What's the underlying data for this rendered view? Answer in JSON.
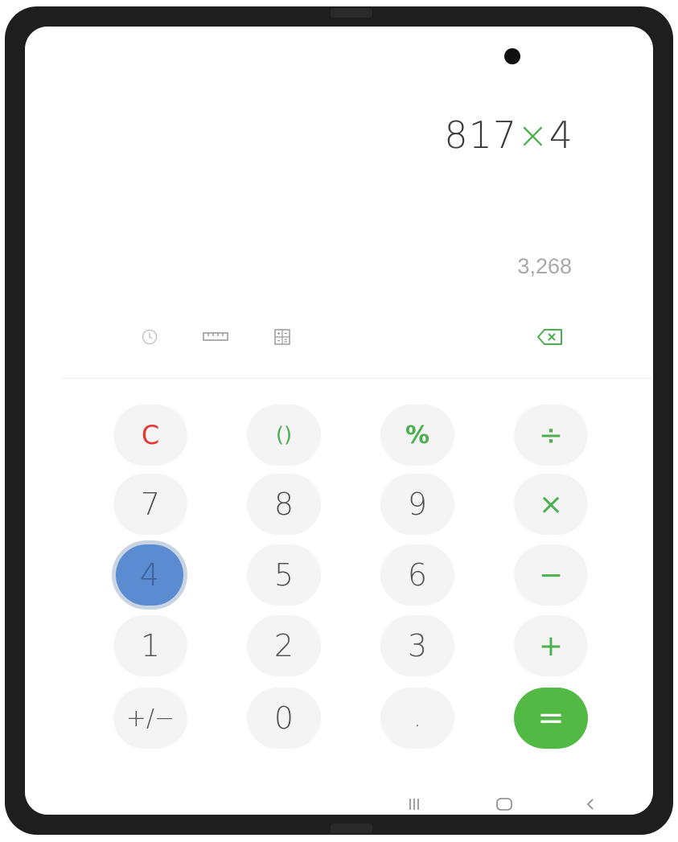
{
  "display": {
    "operand1": "817",
    "operator": "×",
    "operand2": "4",
    "preview": "3,268"
  },
  "toolbar": {
    "history_icon": "clock-icon",
    "converter_icon": "ruler-icon",
    "scientific_icon": "calculator-icon",
    "backspace_icon": "backspace-icon"
  },
  "keys": {
    "clear": "C",
    "parentheses": "()",
    "percent": "%",
    "divide": "÷",
    "seven": "7",
    "eight": "8",
    "nine": "9",
    "multiply": "×",
    "four": "4",
    "five": "5",
    "six": "6",
    "subtract": "−",
    "one": "1",
    "two": "2",
    "three": "3",
    "add": "+",
    "negate": "+/−",
    "zero": "0",
    "decimal": ".",
    "equals": "="
  },
  "navbar": {
    "recents_icon": "recents-icon",
    "home_icon": "home-icon",
    "back_icon": "back-icon"
  },
  "colors": {
    "accent_green": "#52b944",
    "clear_red": "#e53935",
    "pressed_blue": "#5b8bd0"
  }
}
